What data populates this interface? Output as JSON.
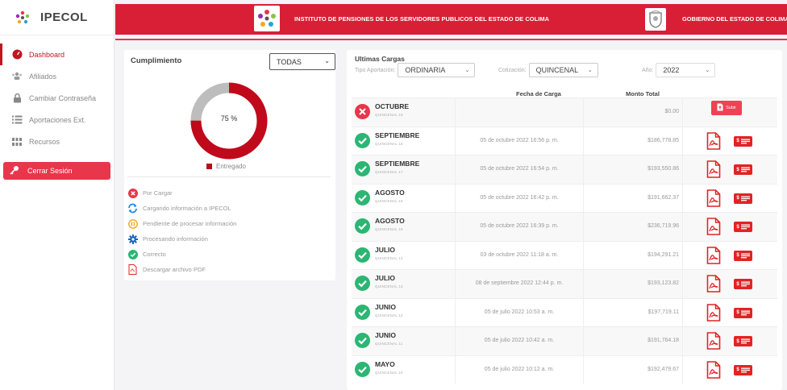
{
  "brand": {
    "name": "IPECOL"
  },
  "sidebar": {
    "items": [
      {
        "label": "Dashboard",
        "icon": "dashboard-gauge-icon",
        "active": true
      },
      {
        "label": "Afiliados",
        "icon": "users-icon",
        "active": false
      },
      {
        "label": "Cambiar Contraseña",
        "icon": "lock-icon",
        "active": false
      },
      {
        "label": "Aportaciones Ext.",
        "icon": "list-icon",
        "active": false
      },
      {
        "label": "Recursos",
        "icon": "grid-icon",
        "active": false
      }
    ],
    "logout_label": "Cerrar Sesión"
  },
  "header": {
    "title_left": "INSTITUTO DE PENSIONES DE LOS SERVIDORES PUBLICOS DEL ESTADO DE COLIMA",
    "title_right": "GOBIERNO DEL ESTADO DE COLIMA"
  },
  "cumplimiento": {
    "title": "Cumplimiento",
    "filter_value": "TODAS",
    "percent_label": "75 %",
    "percent": 75,
    "legend_label": "Entregado",
    "status_legend": [
      {
        "label": "Por Cargar",
        "icon": "x-circle-icon"
      },
      {
        "label": "Cargando información a IPECOL",
        "icon": "sync-icon"
      },
      {
        "label": "Pendiente de procesar información",
        "icon": "pending-circle-icon"
      },
      {
        "label": "Procesando información",
        "icon": "gear-icon"
      },
      {
        "label": "Correcto",
        "icon": "check-circle-icon"
      },
      {
        "label": "Descargar archivo PDF",
        "icon": "pdf-icon"
      }
    ]
  },
  "cargas": {
    "title": "Ultimas Cargas",
    "tipo_label": "Tipo Aportación:",
    "tipo_value": "ORDINARIA",
    "cotizacion_label": "Cotización:",
    "cotizacion_value": "QUINCENAL",
    "anio_label": "Año:",
    "anio_value": "2022",
    "columns": {
      "fecha": "Fecha de Carga",
      "monto": "Monto Total"
    },
    "subir_label": "Subir",
    "money_label": "$",
    "rows": [
      {
        "month": "OCTUBRE",
        "quincena": "QUINCENAL 19",
        "date": "",
        "amount": "$0.00",
        "status": "pending"
      },
      {
        "month": "SEPTIEMBRE",
        "quincena": "QUINCENAL 18",
        "date": "05 de octubre 2022 16:56 p. m.",
        "amount": "$186,778.85",
        "status": "ok"
      },
      {
        "month": "SEPTIEMBRE",
        "quincena": "QUINCENAL 17",
        "date": "05 de octubre 2022 16:54 p. m.",
        "amount": "$193,550.86",
        "status": "ok"
      },
      {
        "month": "AGOSTO",
        "quincena": "QUINCENAL 16",
        "date": "05 de octubre 2022 16:42 p. m.",
        "amount": "$191,662.37",
        "status": "ok"
      },
      {
        "month": "AGOSTO",
        "quincena": "QUINCENAL 15",
        "date": "05 de octubre 2022 16:39 p. m.",
        "amount": "$236,719.96",
        "status": "ok"
      },
      {
        "month": "JULIO",
        "quincena": "QUINCENAL 14",
        "date": "03 de octubre 2022 11:18 a. m.",
        "amount": "$194,291.21",
        "status": "ok"
      },
      {
        "month": "JULIO",
        "quincena": "QUINCENAL 13",
        "date": "08 de septiembre 2022 12:44 p. m.",
        "amount": "$193,123.82",
        "status": "ok"
      },
      {
        "month": "JUNIO",
        "quincena": "QUINCENAL 12",
        "date": "05 de julio 2022 10:53 a. m.",
        "amount": "$197,719.11",
        "status": "ok"
      },
      {
        "month": "JUNIO",
        "quincena": "QUINCENAL 11",
        "date": "05 de julio 2022 10:42 a. m.",
        "amount": "$191,764.18",
        "status": "ok"
      },
      {
        "month": "MAYO",
        "quincena": "QUINCENAL 10",
        "date": "05 de julio 2022 10:12 a. m.",
        "amount": "$192,479.67",
        "status": "ok"
      }
    ]
  },
  "colors": {
    "brand_red": "#d81f35",
    "ok_green": "#2bb673",
    "error_red": "#e8364a",
    "donut_gray": "#bdbdbd",
    "donut_red": "#c0091a"
  }
}
